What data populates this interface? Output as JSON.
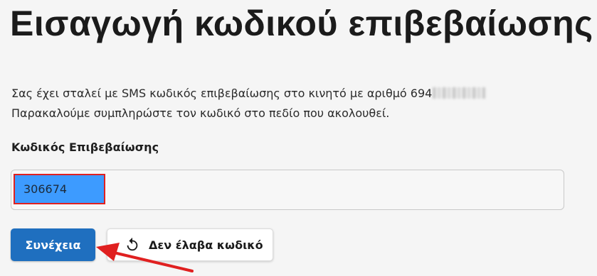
{
  "page": {
    "title": "Εισαγωγή κωδικού επιβεβαίωσης",
    "intro_line1": "Σας έχει σταλεί με SMS κωδικός επιβεβαίωσης στο κινητό με αριθμό 694",
    "intro_line2": "Παρακαλούμε συμπληρώστε τον κωδικό στο πεδίο που ακολουθεί."
  },
  "form": {
    "code_label": "Κωδικός Επιβεβαίωσης",
    "code_value": "306674"
  },
  "actions": {
    "continue_label": "Συνέχεια",
    "resend_label": "Δεν έλαβα κωδικό",
    "resend_icon": "refresh-icon"
  },
  "colors": {
    "primary": "#1f6fbf",
    "selection_highlight": "#3d9bff",
    "annotation_red": "#e02020"
  }
}
